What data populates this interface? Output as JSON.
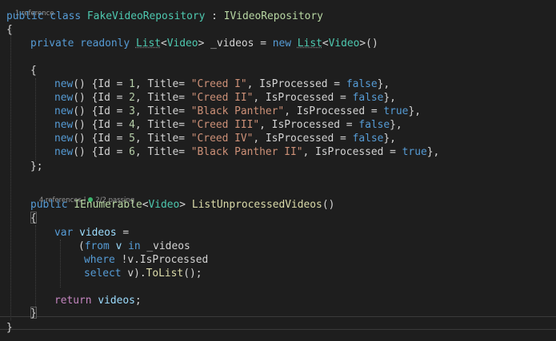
{
  "lens": {
    "class_refs": "1 reference",
    "method_refs": "4 references",
    "separator": "|",
    "tests": "2/2 passing"
  },
  "code": {
    "l1": {
      "public": "public",
      "class": "class",
      "name": "FakeVideoRepository",
      "colon": " : ",
      "iface": "IVideoRepository"
    },
    "l2": {
      "brace": "{"
    },
    "l3": {
      "private": "private",
      "readonly": "readonly",
      "list": "List",
      "lt": "<",
      "video": "Video",
      "gt": "> ",
      "field": "_videos",
      "eq": " = ",
      "new": "new",
      "list2": "List",
      "lt2": "<",
      "video2": "Video",
      "end": ">()"
    },
    "l5": {
      "brace": "{"
    },
    "rows": [
      {
        "new": "new",
        "open": "() {Id = ",
        "id": "1",
        "mid": ", Title= ",
        "title": "\"Creed I\"",
        "mid2": ", IsProcessed = ",
        "flag": "false",
        "end": "},"
      },
      {
        "new": "new",
        "open": "() {Id = ",
        "id": "2",
        "mid": ", Title= ",
        "title": "\"Creed II\"",
        "mid2": ", IsProcessed = ",
        "flag": "false",
        "end": "},"
      },
      {
        "new": "new",
        "open": "() {Id = ",
        "id": "3",
        "mid": ", Title= ",
        "title": "\"Black Panther\"",
        "mid2": ", IsProcessed = ",
        "flag": "true",
        "end": "},"
      },
      {
        "new": "new",
        "open": "() {Id = ",
        "id": "4",
        "mid": ", Title= ",
        "title": "\"Creed III\"",
        "mid2": ", IsProcessed = ",
        "flag": "false",
        "end": "},"
      },
      {
        "new": "new",
        "open": "() {Id = ",
        "id": "5",
        "mid": ", Title= ",
        "title": "\"Creed IV\"",
        "mid2": ", IsProcessed = ",
        "flag": "false",
        "end": "},"
      },
      {
        "new": "new",
        "open": "() {Id = ",
        "id": "6",
        "mid": ", Title= ",
        "title": "\"Black Panther II\"",
        "mid2": ", IsProcessed = ",
        "flag": "true",
        "end": "},"
      }
    ],
    "l12": {
      "end": "};"
    },
    "l14": {
      "public": "public",
      "ienum": "IEnumerable",
      "lt": "<",
      "video": "Video",
      "gt": "> ",
      "method": "ListUnprocessedVideos",
      "end": "()"
    },
    "l15": {
      "brace": "{"
    },
    "l16": {
      "var": "var",
      "name": "videos",
      "eq": " ="
    },
    "l17": {
      "open": "(",
      "from": "from",
      "v": " v ",
      "in": "in",
      "src": " _videos"
    },
    "l18": {
      "where": "where",
      "cond": " !v.IsProcessed"
    },
    "l19": {
      "select": "select",
      "v": " v).",
      "tolist": "ToList",
      "end": "();"
    },
    "l21": {
      "return": "return",
      "name": " videos",
      "semi": ";"
    },
    "l22": {
      "brace": "}"
    },
    "l23": {
      "brace": "}"
    }
  }
}
